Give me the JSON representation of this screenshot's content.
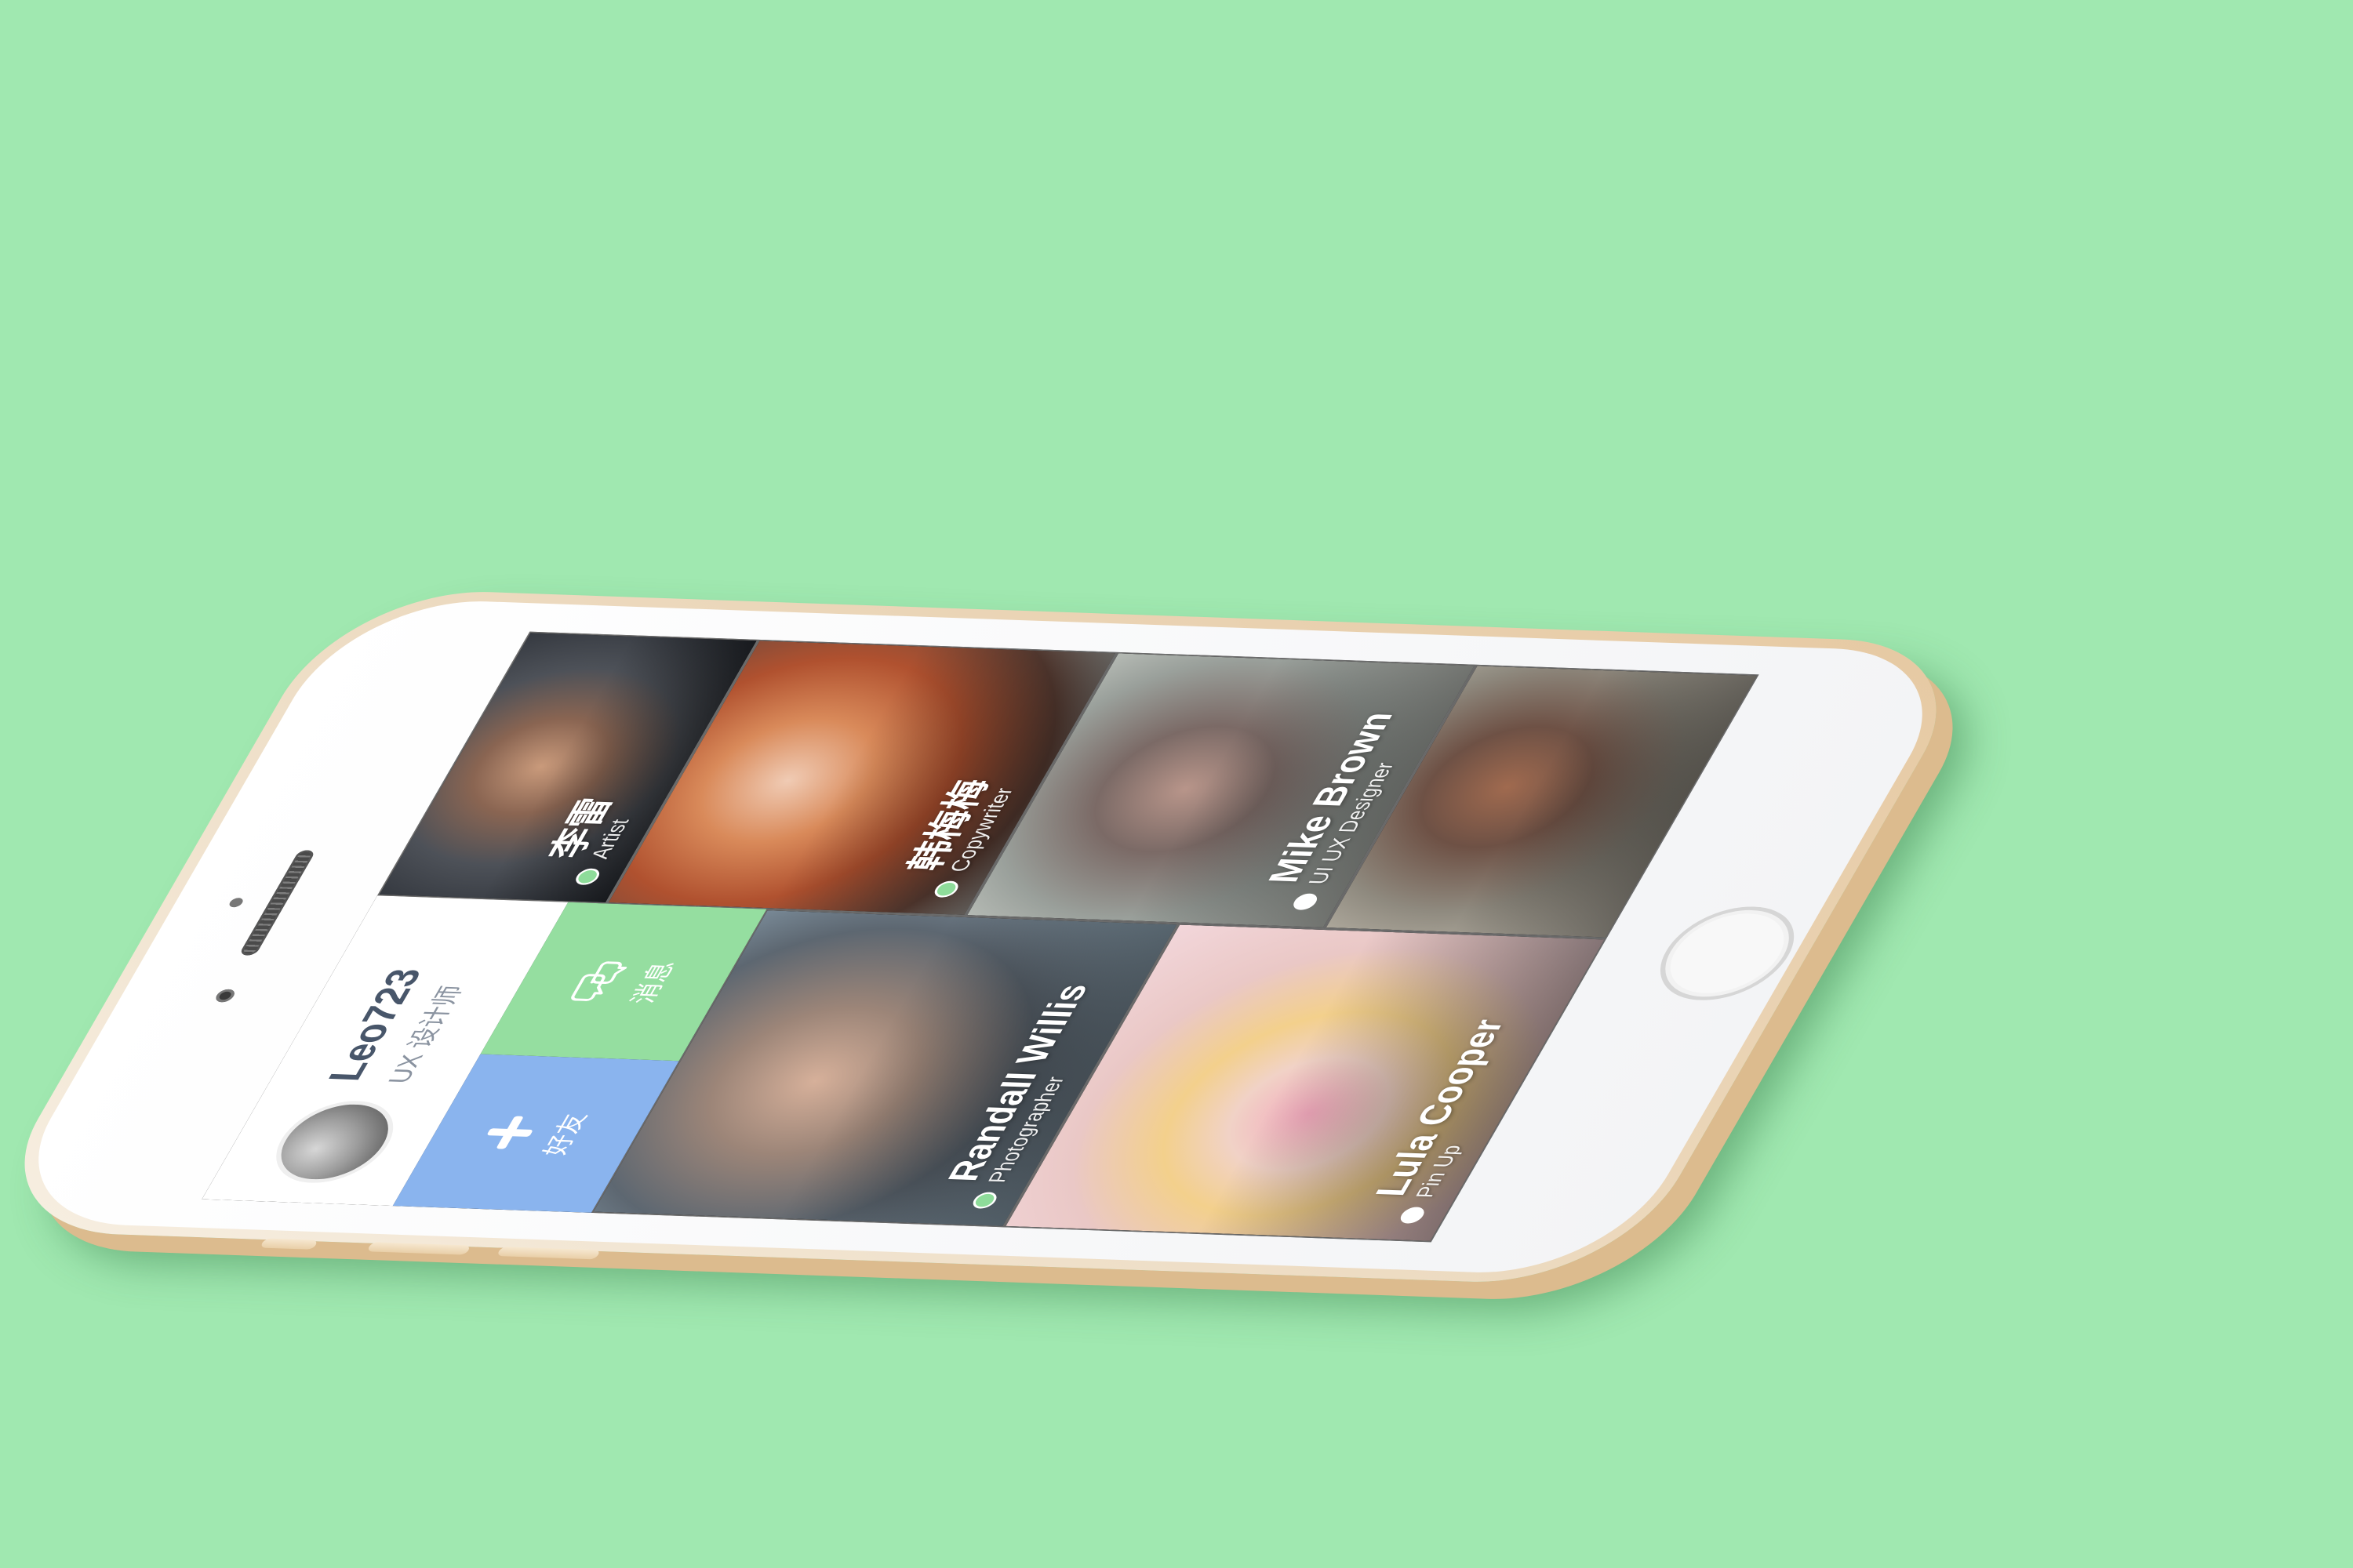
{
  "profile": {
    "username": "Leo723",
    "title": "UX 设计师"
  },
  "actions": {
    "friends_label": "好友",
    "messages_label": "消息"
  },
  "contacts": [
    {
      "name": "李雷",
      "role": "Artist",
      "online": true
    },
    {
      "name": "韩梅梅",
      "role": "Copywriter",
      "online": true
    },
    {
      "name": "Randall Willis",
      "role": "Photographer",
      "online": true
    },
    {
      "name": "Mike Brown",
      "role": "UI UX Designer",
      "online": false
    },
    {
      "name": "Lula Cooper",
      "role": "Pin Up",
      "online": false
    }
  ],
  "colors": {
    "background": "#a0e8b0",
    "friends_tile": "#8ab4ee",
    "messages_tile": "#95dea0",
    "online_dot": "#8edc9a",
    "username": "#48566a"
  },
  "icons": {
    "friends": "plus-icon",
    "messages": "chat-bubbles-icon"
  }
}
